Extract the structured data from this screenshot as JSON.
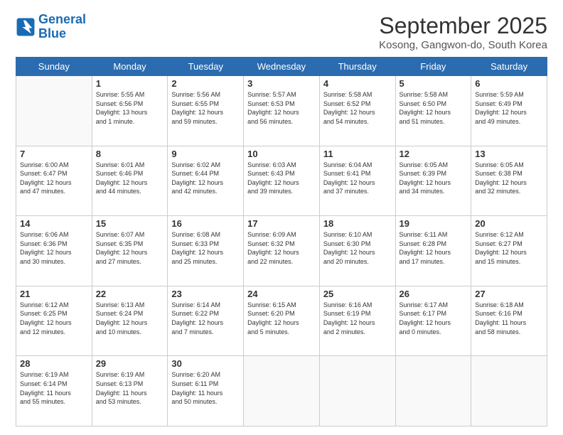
{
  "logo": {
    "line1": "General",
    "line2": "Blue"
  },
  "title": "September 2025",
  "location": "Kosong, Gangwon-do, South Korea",
  "days_of_week": [
    "Sunday",
    "Monday",
    "Tuesday",
    "Wednesday",
    "Thursday",
    "Friday",
    "Saturday"
  ],
  "weeks": [
    [
      {
        "day": "",
        "info": ""
      },
      {
        "day": "1",
        "info": "Sunrise: 5:55 AM\nSunset: 6:56 PM\nDaylight: 13 hours\nand 1 minute."
      },
      {
        "day": "2",
        "info": "Sunrise: 5:56 AM\nSunset: 6:55 PM\nDaylight: 12 hours\nand 59 minutes."
      },
      {
        "day": "3",
        "info": "Sunrise: 5:57 AM\nSunset: 6:53 PM\nDaylight: 12 hours\nand 56 minutes."
      },
      {
        "day": "4",
        "info": "Sunrise: 5:58 AM\nSunset: 6:52 PM\nDaylight: 12 hours\nand 54 minutes."
      },
      {
        "day": "5",
        "info": "Sunrise: 5:58 AM\nSunset: 6:50 PM\nDaylight: 12 hours\nand 51 minutes."
      },
      {
        "day": "6",
        "info": "Sunrise: 5:59 AM\nSunset: 6:49 PM\nDaylight: 12 hours\nand 49 minutes."
      }
    ],
    [
      {
        "day": "7",
        "info": "Sunrise: 6:00 AM\nSunset: 6:47 PM\nDaylight: 12 hours\nand 47 minutes."
      },
      {
        "day": "8",
        "info": "Sunrise: 6:01 AM\nSunset: 6:46 PM\nDaylight: 12 hours\nand 44 minutes."
      },
      {
        "day": "9",
        "info": "Sunrise: 6:02 AM\nSunset: 6:44 PM\nDaylight: 12 hours\nand 42 minutes."
      },
      {
        "day": "10",
        "info": "Sunrise: 6:03 AM\nSunset: 6:43 PM\nDaylight: 12 hours\nand 39 minutes."
      },
      {
        "day": "11",
        "info": "Sunrise: 6:04 AM\nSunset: 6:41 PM\nDaylight: 12 hours\nand 37 minutes."
      },
      {
        "day": "12",
        "info": "Sunrise: 6:05 AM\nSunset: 6:39 PM\nDaylight: 12 hours\nand 34 minutes."
      },
      {
        "day": "13",
        "info": "Sunrise: 6:05 AM\nSunset: 6:38 PM\nDaylight: 12 hours\nand 32 minutes."
      }
    ],
    [
      {
        "day": "14",
        "info": "Sunrise: 6:06 AM\nSunset: 6:36 PM\nDaylight: 12 hours\nand 30 minutes."
      },
      {
        "day": "15",
        "info": "Sunrise: 6:07 AM\nSunset: 6:35 PM\nDaylight: 12 hours\nand 27 minutes."
      },
      {
        "day": "16",
        "info": "Sunrise: 6:08 AM\nSunset: 6:33 PM\nDaylight: 12 hours\nand 25 minutes."
      },
      {
        "day": "17",
        "info": "Sunrise: 6:09 AM\nSunset: 6:32 PM\nDaylight: 12 hours\nand 22 minutes."
      },
      {
        "day": "18",
        "info": "Sunrise: 6:10 AM\nSunset: 6:30 PM\nDaylight: 12 hours\nand 20 minutes."
      },
      {
        "day": "19",
        "info": "Sunrise: 6:11 AM\nSunset: 6:28 PM\nDaylight: 12 hours\nand 17 minutes."
      },
      {
        "day": "20",
        "info": "Sunrise: 6:12 AM\nSunset: 6:27 PM\nDaylight: 12 hours\nand 15 minutes."
      }
    ],
    [
      {
        "day": "21",
        "info": "Sunrise: 6:12 AM\nSunset: 6:25 PM\nDaylight: 12 hours\nand 12 minutes."
      },
      {
        "day": "22",
        "info": "Sunrise: 6:13 AM\nSunset: 6:24 PM\nDaylight: 12 hours\nand 10 minutes."
      },
      {
        "day": "23",
        "info": "Sunrise: 6:14 AM\nSunset: 6:22 PM\nDaylight: 12 hours\nand 7 minutes."
      },
      {
        "day": "24",
        "info": "Sunrise: 6:15 AM\nSunset: 6:20 PM\nDaylight: 12 hours\nand 5 minutes."
      },
      {
        "day": "25",
        "info": "Sunrise: 6:16 AM\nSunset: 6:19 PM\nDaylight: 12 hours\nand 2 minutes."
      },
      {
        "day": "26",
        "info": "Sunrise: 6:17 AM\nSunset: 6:17 PM\nDaylight: 12 hours\nand 0 minutes."
      },
      {
        "day": "27",
        "info": "Sunrise: 6:18 AM\nSunset: 6:16 PM\nDaylight: 11 hours\nand 58 minutes."
      }
    ],
    [
      {
        "day": "28",
        "info": "Sunrise: 6:19 AM\nSunset: 6:14 PM\nDaylight: 11 hours\nand 55 minutes."
      },
      {
        "day": "29",
        "info": "Sunrise: 6:19 AM\nSunset: 6:13 PM\nDaylight: 11 hours\nand 53 minutes."
      },
      {
        "day": "30",
        "info": "Sunrise: 6:20 AM\nSunset: 6:11 PM\nDaylight: 11 hours\nand 50 minutes."
      },
      {
        "day": "",
        "info": ""
      },
      {
        "day": "",
        "info": ""
      },
      {
        "day": "",
        "info": ""
      },
      {
        "day": "",
        "info": ""
      }
    ]
  ]
}
